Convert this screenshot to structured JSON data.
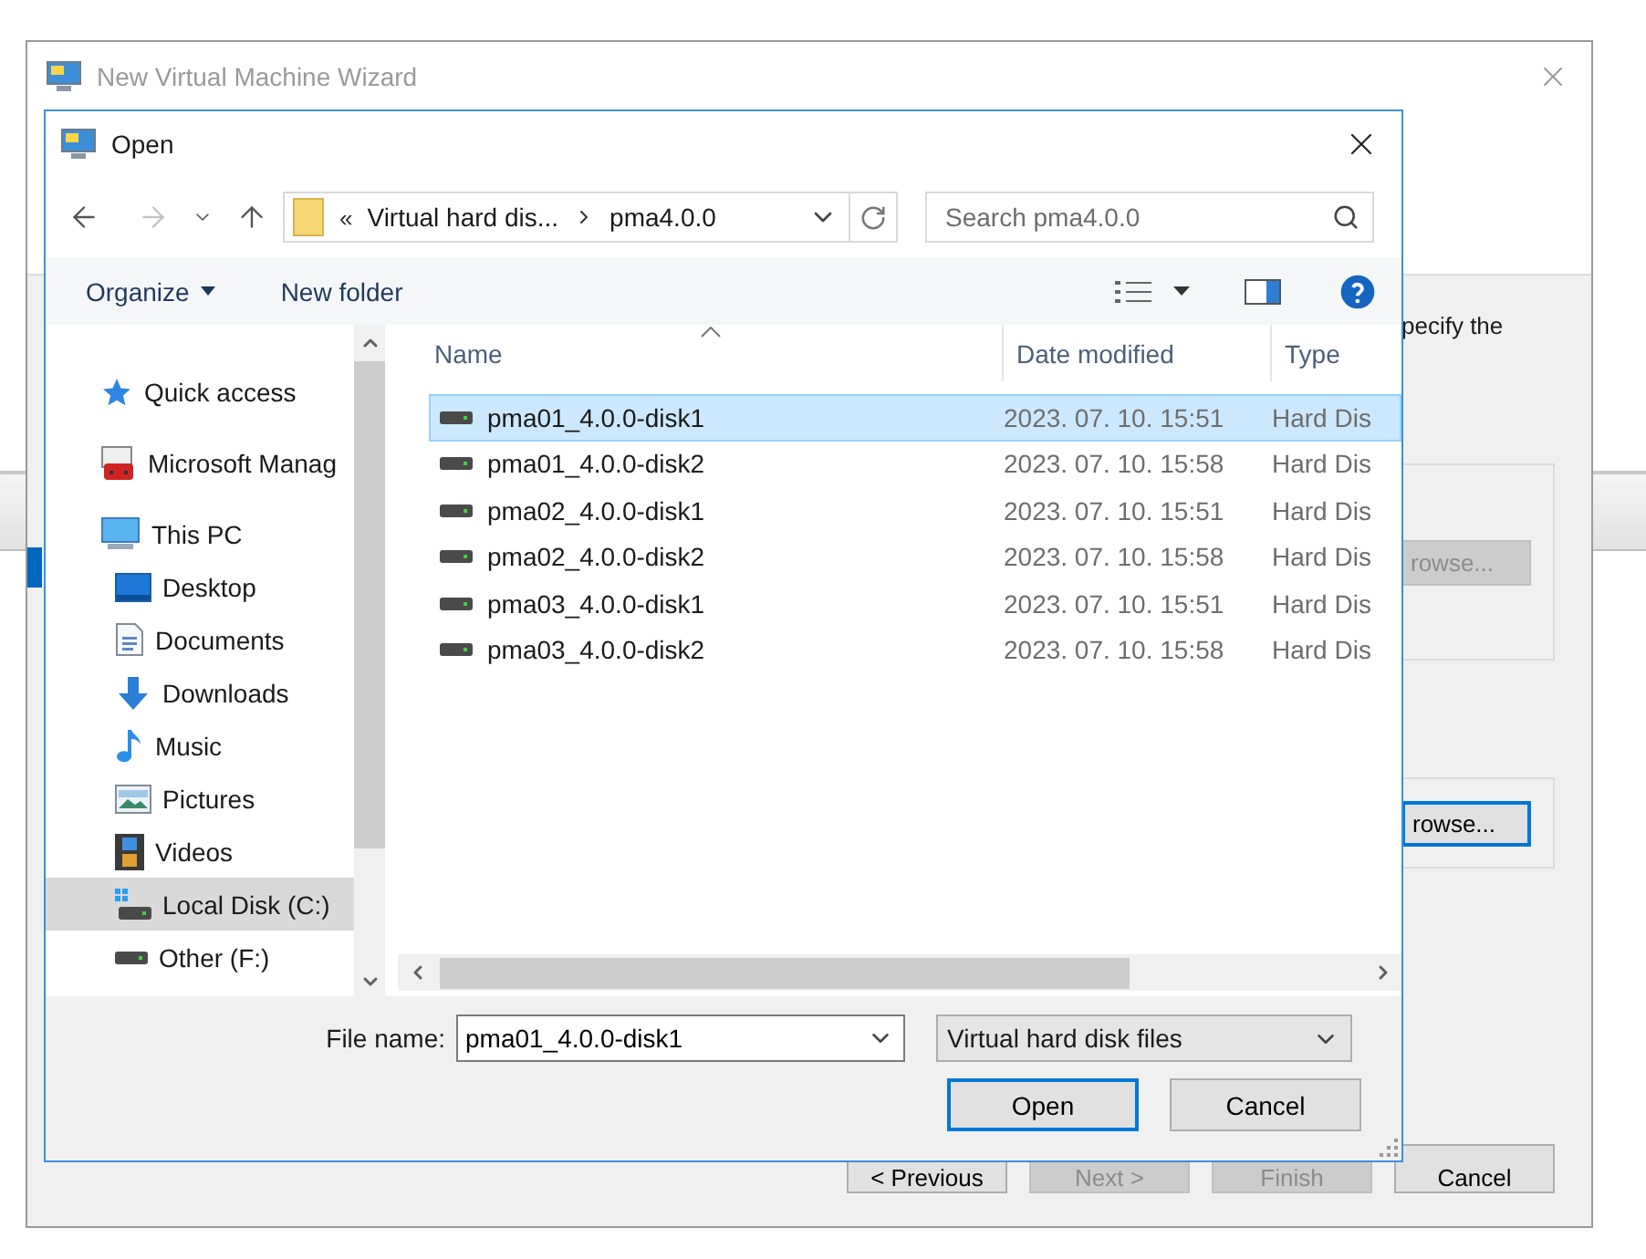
{
  "wizard": {
    "title": "New Virtual Machine Wizard",
    "instruction": "pecify the",
    "browse_buttons": [
      {
        "label": "rowse...",
        "disabled": true,
        "focused": false
      },
      {
        "label": "rowse...",
        "disabled": false,
        "focused": true
      }
    ],
    "footer_buttons": [
      {
        "label": "< Previous",
        "disabled": false
      },
      {
        "label": "Next >",
        "disabled": true
      },
      {
        "label": "Finish",
        "disabled": true
      },
      {
        "label": "Cancel",
        "disabled": false
      }
    ]
  },
  "open_dialog": {
    "title": "Open",
    "nav_buttons": [
      {
        "kind": "back",
        "disabled": false
      },
      {
        "kind": "forward",
        "disabled": true
      },
      {
        "kind": "recent",
        "disabled": false
      },
      {
        "kind": "up",
        "disabled": false
      }
    ],
    "address_bar": {
      "overflow": "«",
      "segments": [
        "Virtual hard dis...",
        "pma4.0.0"
      ]
    },
    "search": {
      "placeholder": "Search pma4.0.0"
    },
    "toolbar": [
      {
        "label": "Organize",
        "dropdown": true
      },
      {
        "label": "New folder",
        "dropdown": false
      }
    ],
    "navigation_pane": [
      {
        "label": "Quick access",
        "selected": false
      },
      {
        "label": "Microsoft Manag",
        "selected": false
      },
      {
        "label": "This PC",
        "selected": false,
        "children": [
          {
            "label": "Desktop",
            "selected": false
          },
          {
            "label": "Documents",
            "selected": false
          },
          {
            "label": "Downloads",
            "selected": false
          },
          {
            "label": "Music",
            "selected": false
          },
          {
            "label": "Pictures",
            "selected": false
          },
          {
            "label": "Videos",
            "selected": false
          },
          {
            "label": "Local Disk (C:)",
            "selected": true
          },
          {
            "label": "Other (F:)",
            "selected": false
          }
        ]
      }
    ],
    "columns": [
      "Name",
      "Date modified",
      "Type"
    ],
    "files": [
      {
        "name": "pma01_4.0.0-disk1",
        "date_modified": "2023. 07. 10. 15:51",
        "type": "Hard Dis",
        "selected": true
      },
      {
        "name": "pma01_4.0.0-disk2",
        "date_modified": "2023. 07. 10. 15:58",
        "type": "Hard Dis",
        "selected": false
      },
      {
        "name": "pma02_4.0.0-disk1",
        "date_modified": "2023. 07. 10. 15:51",
        "type": "Hard Dis",
        "selected": false
      },
      {
        "name": "pma02_4.0.0-disk2",
        "date_modified": "2023. 07. 10. 15:58",
        "type": "Hard Dis",
        "selected": false
      },
      {
        "name": "pma03_4.0.0-disk1",
        "date_modified": "2023. 07. 10. 15:51",
        "type": "Hard Dis",
        "selected": false
      },
      {
        "name": "pma03_4.0.0-disk2",
        "date_modified": "2023. 07. 10. 15:58",
        "type": "Hard Dis",
        "selected": false
      }
    ],
    "file_name": {
      "label": "File name:",
      "value": "pma01_4.0.0-disk1"
    },
    "file_type": "Virtual hard disk files",
    "buttons": [
      {
        "label": "Open",
        "default": true
      },
      {
        "label": "Cancel",
        "default": false
      }
    ]
  }
}
